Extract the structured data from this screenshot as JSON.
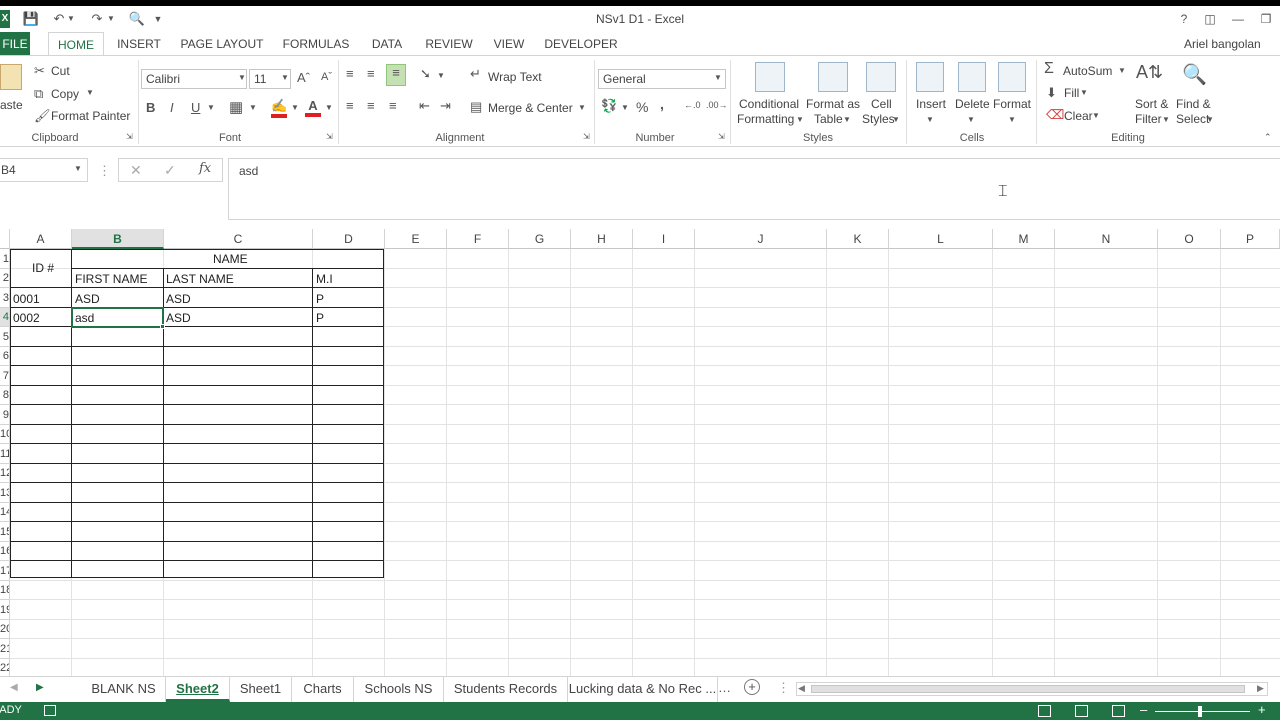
{
  "window": {
    "title": "NSv1 D1 - Excel",
    "user": "Ariel bangolan"
  },
  "qat": {
    "icons": [
      "excel-logo-icon",
      "save-icon",
      "undo-icon",
      "redo-icon",
      "print-preview-icon",
      "customize-qat-icon"
    ]
  },
  "tabs": [
    {
      "label": "FILE",
      "name": "tab-file"
    },
    {
      "label": "HOME",
      "name": "tab-home"
    },
    {
      "label": "INSERT",
      "name": "tab-insert"
    },
    {
      "label": "PAGE LAYOUT",
      "name": "tab-page-layout"
    },
    {
      "label": "FORMULAS",
      "name": "tab-formulas"
    },
    {
      "label": "DATA",
      "name": "tab-data"
    },
    {
      "label": "REVIEW",
      "name": "tab-review"
    },
    {
      "label": "VIEW",
      "name": "tab-view"
    },
    {
      "label": "DEVELOPER",
      "name": "tab-developer"
    }
  ],
  "ribbon": {
    "clipboard": {
      "paste": "Paste",
      "cut": "Cut",
      "copy": "Copy",
      "format_painter": "Format Painter",
      "label": "Clipboard"
    },
    "font": {
      "family": "Calibri",
      "size": "11",
      "label": "Font",
      "bold": "B",
      "italic": "I",
      "underline": "U"
    },
    "alignment": {
      "wrap": "Wrap Text",
      "merge": "Merge & Center",
      "label": "Alignment"
    },
    "number": {
      "format": "General",
      "label": "Number",
      "percent": "%",
      "comma": ","
    },
    "styles": {
      "cond1": "Conditional",
      "cond2": "Formatting",
      "fmt1": "Format as",
      "fmt2": "Table",
      "cell1": "Cell",
      "cell2": "Styles",
      "label": "Styles"
    },
    "cells": {
      "insert": "Insert",
      "delete": "Delete",
      "format": "Format",
      "label": "Cells"
    },
    "editing": {
      "autosum": "AutoSum",
      "fill": "Fill",
      "clear": "Clear",
      "sort1": "Sort &",
      "sort2": "Filter",
      "find1": "Find &",
      "find2": "Select",
      "label": "Editing"
    }
  },
  "formula_bar": {
    "name_box": "B4",
    "value": "asd",
    "fx": "fx"
  },
  "columns": [
    "A",
    "B",
    "C",
    "D",
    "E",
    "F",
    "G",
    "H",
    "I",
    "J",
    "K",
    "L",
    "M",
    "N",
    "O",
    "P"
  ],
  "rows": [
    "1",
    "2",
    "3",
    "4",
    "5",
    "6",
    "7",
    "8",
    "9",
    "10",
    "11",
    "12",
    "13",
    "14",
    "15",
    "16",
    "17",
    "18",
    "19",
    "20",
    "21",
    "22"
  ],
  "sheet": {
    "header_id": "ID #",
    "header_name": "NAME",
    "header_first": "FIRST NAME",
    "header_last": "LAST NAME",
    "header_mi": "M.I",
    "data": [
      {
        "id": "0001",
        "first": "ASD",
        "last": "ASD",
        "mi": "P"
      },
      {
        "id": "0002",
        "first": "asd",
        "last": "ASD",
        "mi": "P"
      }
    ]
  },
  "sheet_tabs": [
    {
      "label": "BLANK NS",
      "active": false
    },
    {
      "label": "Sheet2",
      "active": true
    },
    {
      "label": "Sheet1",
      "active": false
    },
    {
      "label": "Charts",
      "active": false
    },
    {
      "label": "Schools NS",
      "active": false
    },
    {
      "label": "Students Records",
      "active": false
    },
    {
      "label": "Lucking data & No Rec ...",
      "active": false
    }
  ],
  "status": {
    "mode": "READY"
  },
  "colors": {
    "accent": "#217346"
  }
}
